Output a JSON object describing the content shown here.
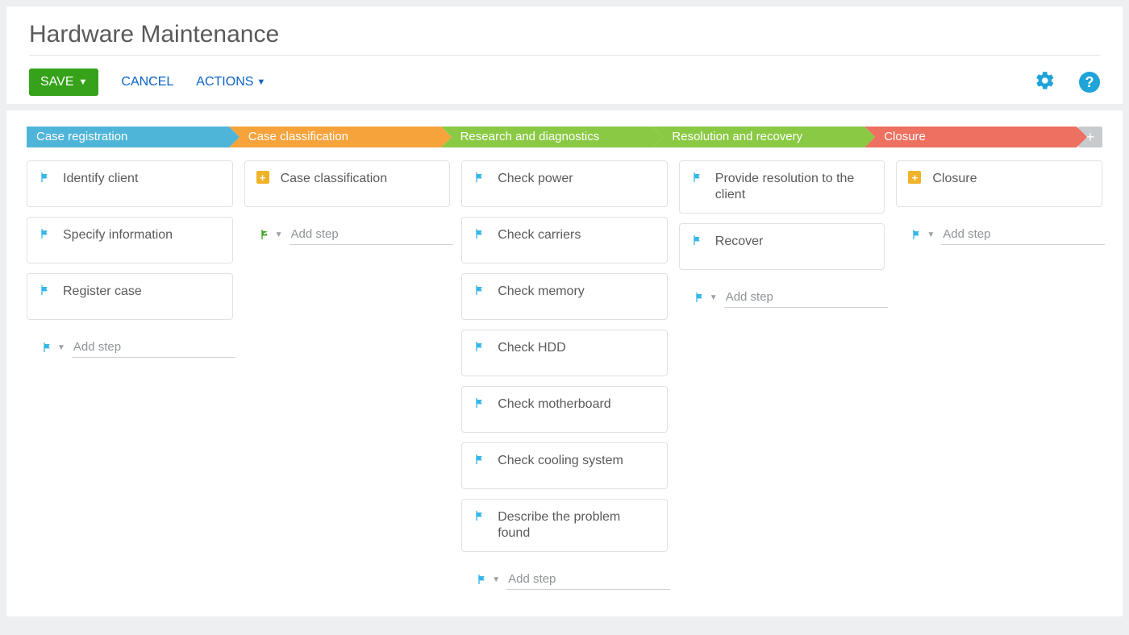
{
  "header": {
    "title": "Hardware Maintenance",
    "save_label": "SAVE",
    "cancel_label": "CANCEL",
    "actions_label": "ACTIONS"
  },
  "add_step_placeholder": "Add step",
  "stages": [
    {
      "label": "Case registration",
      "color": "blue",
      "add_icon": "flag-blue",
      "steps": [
        {
          "label": "Identify client",
          "icon": "flag-blue"
        },
        {
          "label": "Specify information",
          "icon": "flag-blue"
        },
        {
          "label": "Register case",
          "icon": "flag-blue"
        }
      ]
    },
    {
      "label": "Case classification",
      "color": "orange",
      "add_icon": "checkflag",
      "steps": [
        {
          "label": "Case classification",
          "icon": "plus-badge"
        }
      ]
    },
    {
      "label": "Research and diagnostics",
      "color": "green",
      "add_icon": "flag-blue",
      "steps": [
        {
          "label": "Check power",
          "icon": "flag-blue"
        },
        {
          "label": "Check carriers",
          "icon": "flag-blue"
        },
        {
          "label": "Check memory",
          "icon": "flag-blue"
        },
        {
          "label": "Check HDD",
          "icon": "flag-blue"
        },
        {
          "label": "Check motherboard",
          "icon": "flag-blue"
        },
        {
          "label": "Check cooling system",
          "icon": "flag-blue"
        },
        {
          "label": "Describe the problem found",
          "icon": "flag-blue"
        }
      ]
    },
    {
      "label": "Resolution and recovery",
      "color": "green2",
      "add_icon": "flag-blue",
      "steps": [
        {
          "label": "Provide resolution to the client",
          "icon": "flag-blue"
        },
        {
          "label": "Recover",
          "icon": "flag-blue"
        }
      ]
    },
    {
      "label": "Closure",
      "color": "red",
      "add_icon": "flag-blue",
      "steps": [
        {
          "label": "Closure",
          "icon": "plus-badge"
        }
      ]
    }
  ]
}
